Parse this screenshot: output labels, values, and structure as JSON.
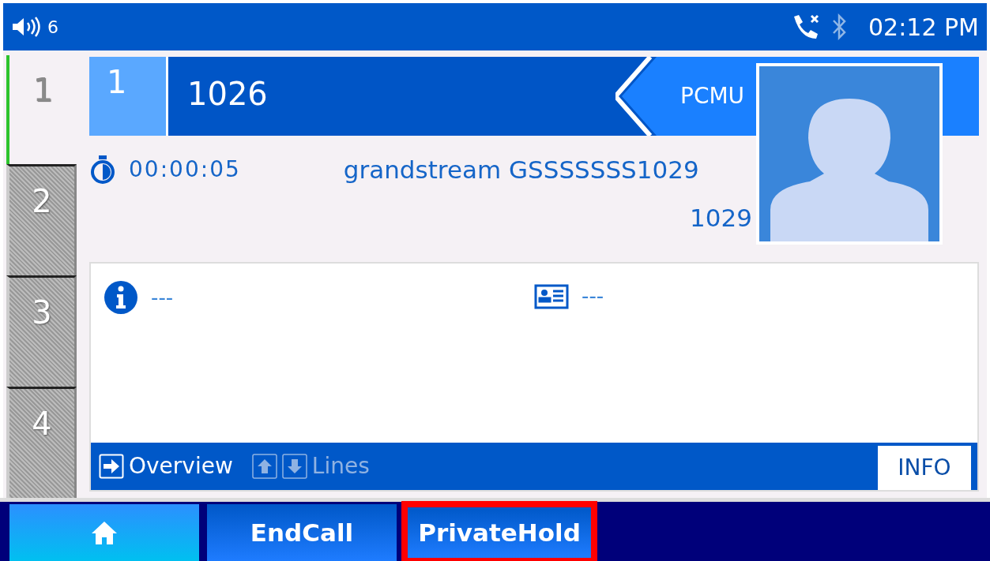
{
  "status_bar": {
    "volume": "6",
    "time": "02:12 PM"
  },
  "line_tabs": [
    {
      "label": "1",
      "selected": true
    },
    {
      "label": "2",
      "selected": false
    },
    {
      "label": "3",
      "selected": false
    },
    {
      "label": "4",
      "selected": false
    }
  ],
  "call": {
    "line": "1",
    "number": "1026",
    "codec": "PCMU",
    "duration": "00:00:05",
    "name": "grandstream GSSSSSSS1029",
    "remote_number": "1029"
  },
  "info_panel": {
    "items": [
      {
        "kind": "info",
        "value": "---"
      },
      {
        "kind": "contact",
        "value": "---"
      }
    ],
    "overview": "Overview",
    "lines": "Lines",
    "tab": "INFO"
  },
  "softkeys": [
    {
      "kind": "home",
      "selected": true,
      "highlighted": false
    },
    {
      "kind": "text",
      "label": "EndCall",
      "selected": false,
      "highlighted": false
    },
    {
      "kind": "text",
      "label": "PrivateHold",
      "selected": false,
      "highlighted": true
    }
  ]
}
